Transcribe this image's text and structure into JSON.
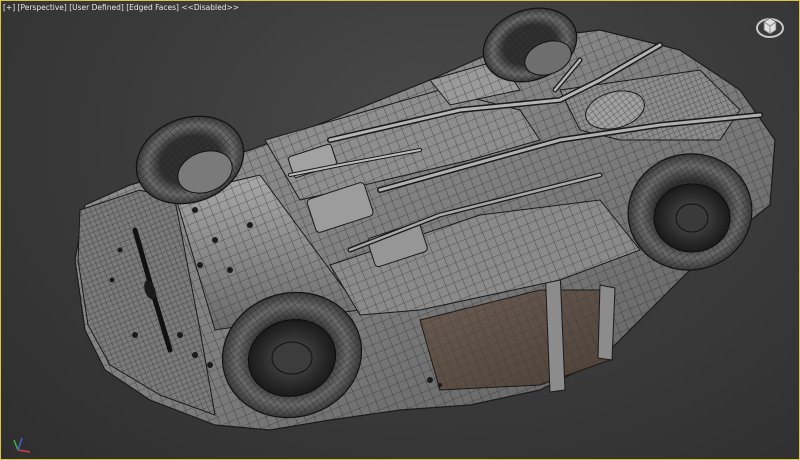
{
  "viewport": {
    "labels": {
      "view_menu": "[+]",
      "projection": "[Perspective]",
      "shading": "[User Defined]",
      "display": "[Edged Faces]",
      "extra": "<<Disabled>>"
    },
    "active_border_color": "#d9c44a",
    "background_color": "#3a3a3a"
  },
  "viewcube": {
    "icon": "viewcube-icon"
  },
  "axis_tripod": {
    "icon": "axis-tripod-icon",
    "x_color": "#d04040",
    "y_color": "#40b040",
    "z_color": "#4060d0"
  },
  "model": {
    "description_icon": "car-underbody-wireframe",
    "wire_color": "#1a1a1a",
    "surface_color": "#8a8a8a"
  }
}
